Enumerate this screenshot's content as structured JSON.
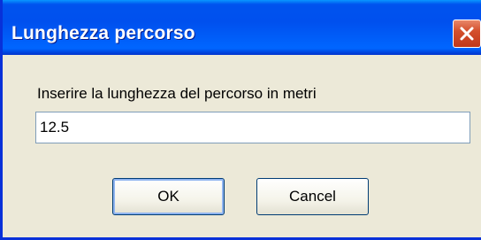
{
  "window": {
    "title": "Lunghezza percorso",
    "close_icon": "close-icon"
  },
  "dialog": {
    "prompt": "Inserire la lunghezza del percorso in metri",
    "input_value": "12.5",
    "ok_label": "OK",
    "cancel_label": "Cancel"
  },
  "colors": {
    "titlebar": "#0053ee",
    "window_bg": "#ece9d8",
    "close_button": "#d4502d"
  }
}
